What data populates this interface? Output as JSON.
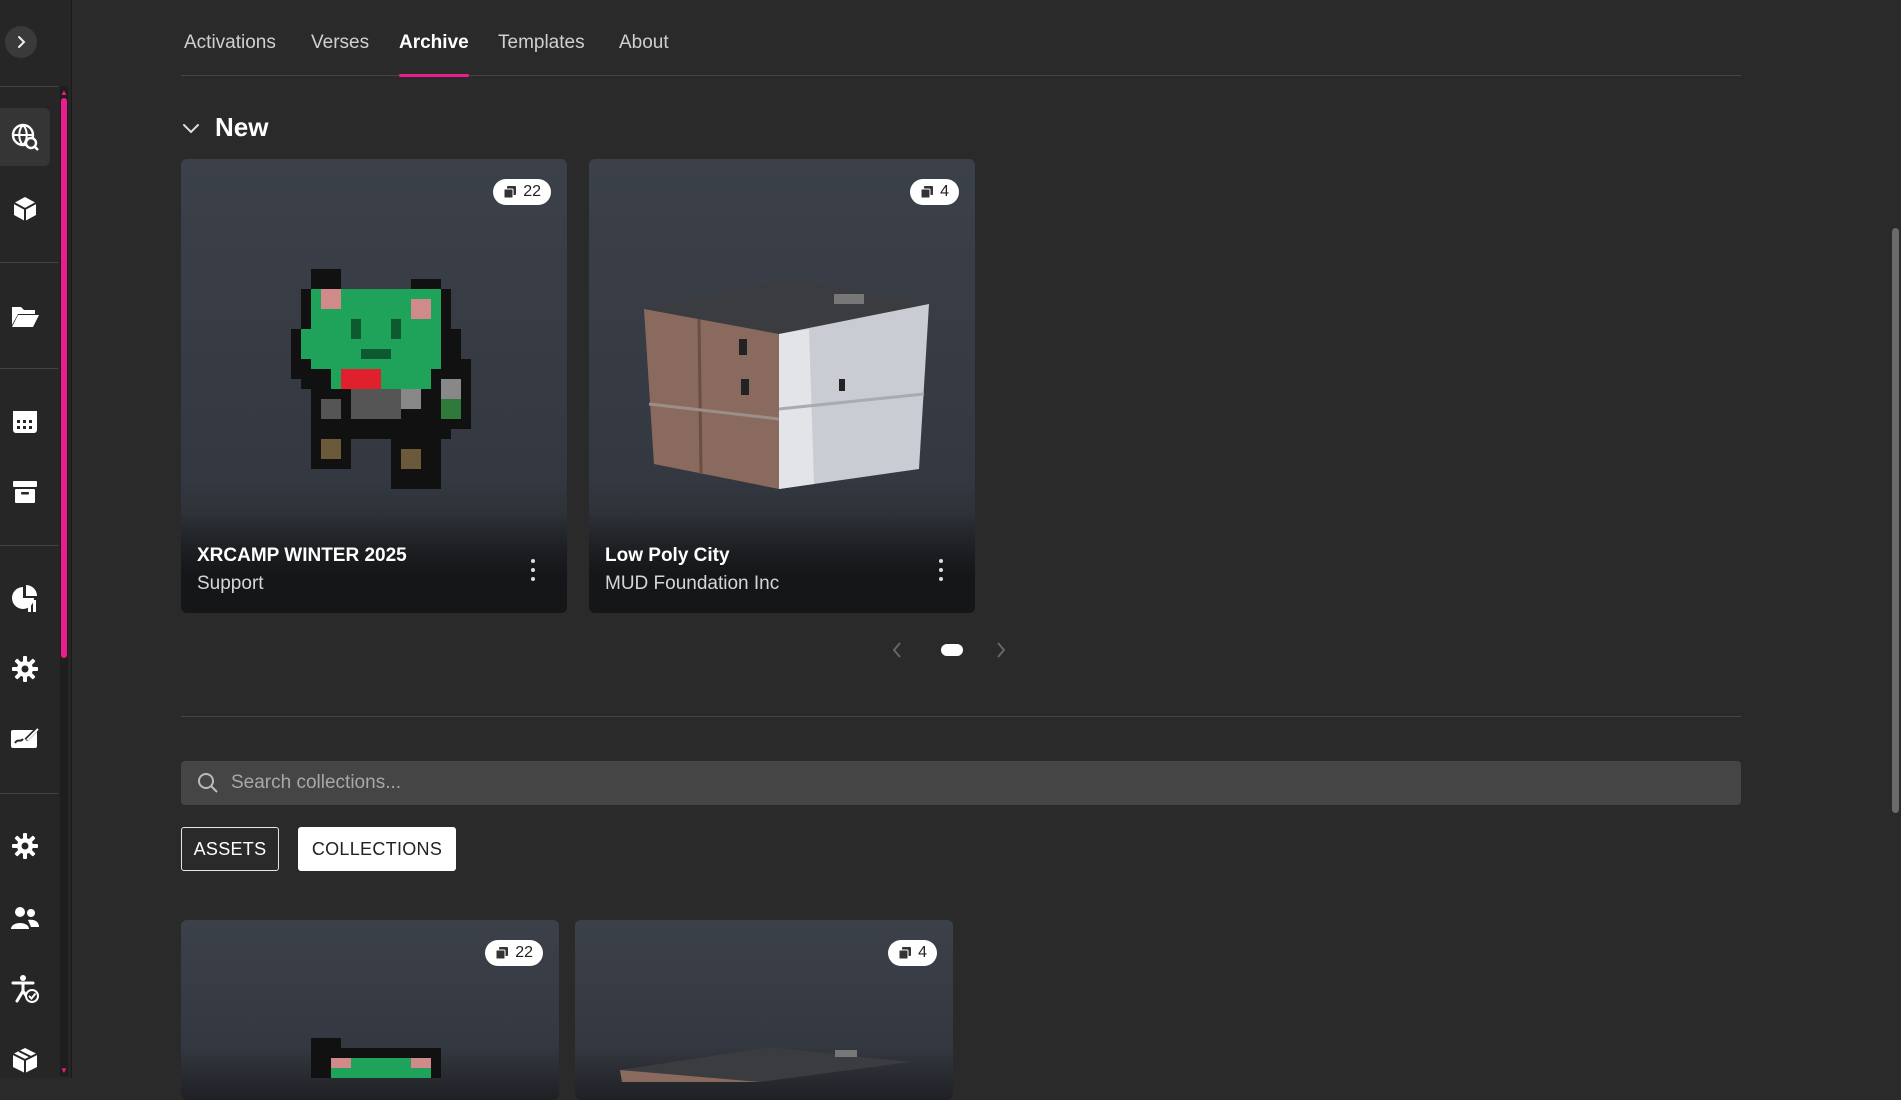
{
  "sidebar": {
    "items": [
      {
        "icon": "globe-search-icon",
        "active": true
      },
      {
        "icon": "cube-icon"
      },
      {
        "icon": "folder-open-icon"
      },
      {
        "icon": "calendar-icon"
      },
      {
        "icon": "archive-box-icon"
      },
      {
        "icon": "chart-pie-icon"
      },
      {
        "icon": "gear-icon"
      },
      {
        "icon": "signature-card-icon"
      },
      {
        "icon": "gear-icon"
      },
      {
        "icon": "users-icon"
      },
      {
        "icon": "person-check-icon"
      },
      {
        "icon": "package-icon"
      }
    ],
    "accent": "#e91e8c"
  },
  "tabs": [
    {
      "label": "Activations"
    },
    {
      "label": "Verses"
    },
    {
      "label": "Archive",
      "active": true
    },
    {
      "label": "Templates"
    },
    {
      "label": "About"
    }
  ],
  "section": {
    "title": "New"
  },
  "cards": [
    {
      "title": "XRCAMP WINTER 2025",
      "subtitle": "Support",
      "count": "22"
    },
    {
      "title": "Low Poly City",
      "subtitle": "MUD Foundation Inc",
      "count": "4"
    }
  ],
  "search": {
    "placeholder": "Search collections..."
  },
  "filters": {
    "assets": "ASSETS",
    "collections": "COLLECTIONS"
  },
  "grid": [
    {
      "count": "22"
    },
    {
      "count": "4"
    }
  ]
}
